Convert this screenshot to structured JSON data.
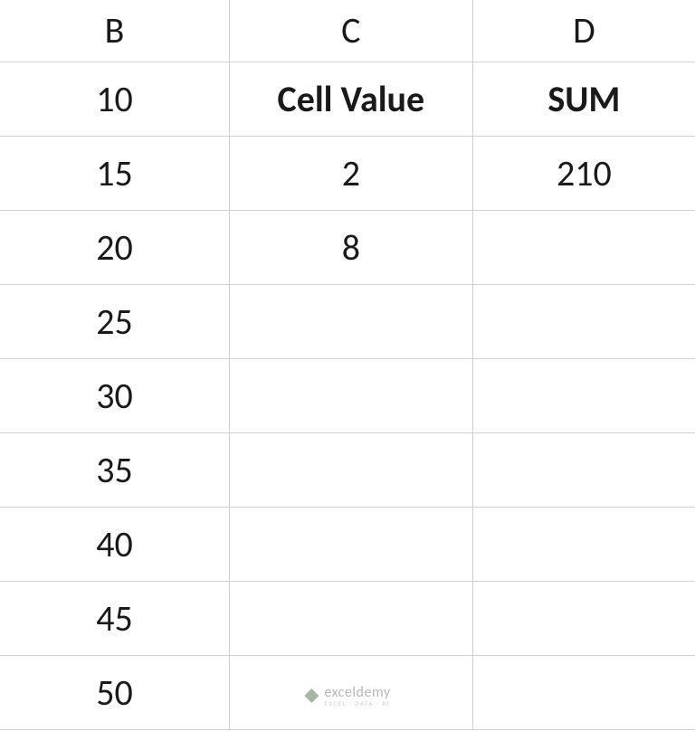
{
  "columns": {
    "b": "B",
    "c": "C",
    "d": "D"
  },
  "rows": [
    {
      "b": "10",
      "c": "Cell Value",
      "d": "SUM",
      "c_bold": true,
      "d_bold": true
    },
    {
      "b": "15",
      "c": "2",
      "d": "210"
    },
    {
      "b": "20",
      "c": "8",
      "d": ""
    },
    {
      "b": "25",
      "c": "",
      "d": ""
    },
    {
      "b": "30",
      "c": "",
      "d": ""
    },
    {
      "b": "35",
      "c": "",
      "d": ""
    },
    {
      "b": "40",
      "c": "",
      "d": ""
    },
    {
      "b": "45",
      "c": "",
      "d": ""
    },
    {
      "b": "50",
      "c": "",
      "d": ""
    }
  ],
  "watermark": {
    "name": "exceldemy",
    "tagline": "EXCEL · DATA · BI"
  },
  "chart_data": {
    "type": "table",
    "column_headers": [
      "B",
      "C",
      "D"
    ],
    "data_labels": {
      "C": "Cell Value",
      "D": "SUM"
    },
    "column_b_values": [
      10,
      15,
      20,
      25,
      30,
      35,
      40,
      45,
      50
    ],
    "column_c_values": [
      2,
      8
    ],
    "column_d_values": [
      210
    ]
  }
}
